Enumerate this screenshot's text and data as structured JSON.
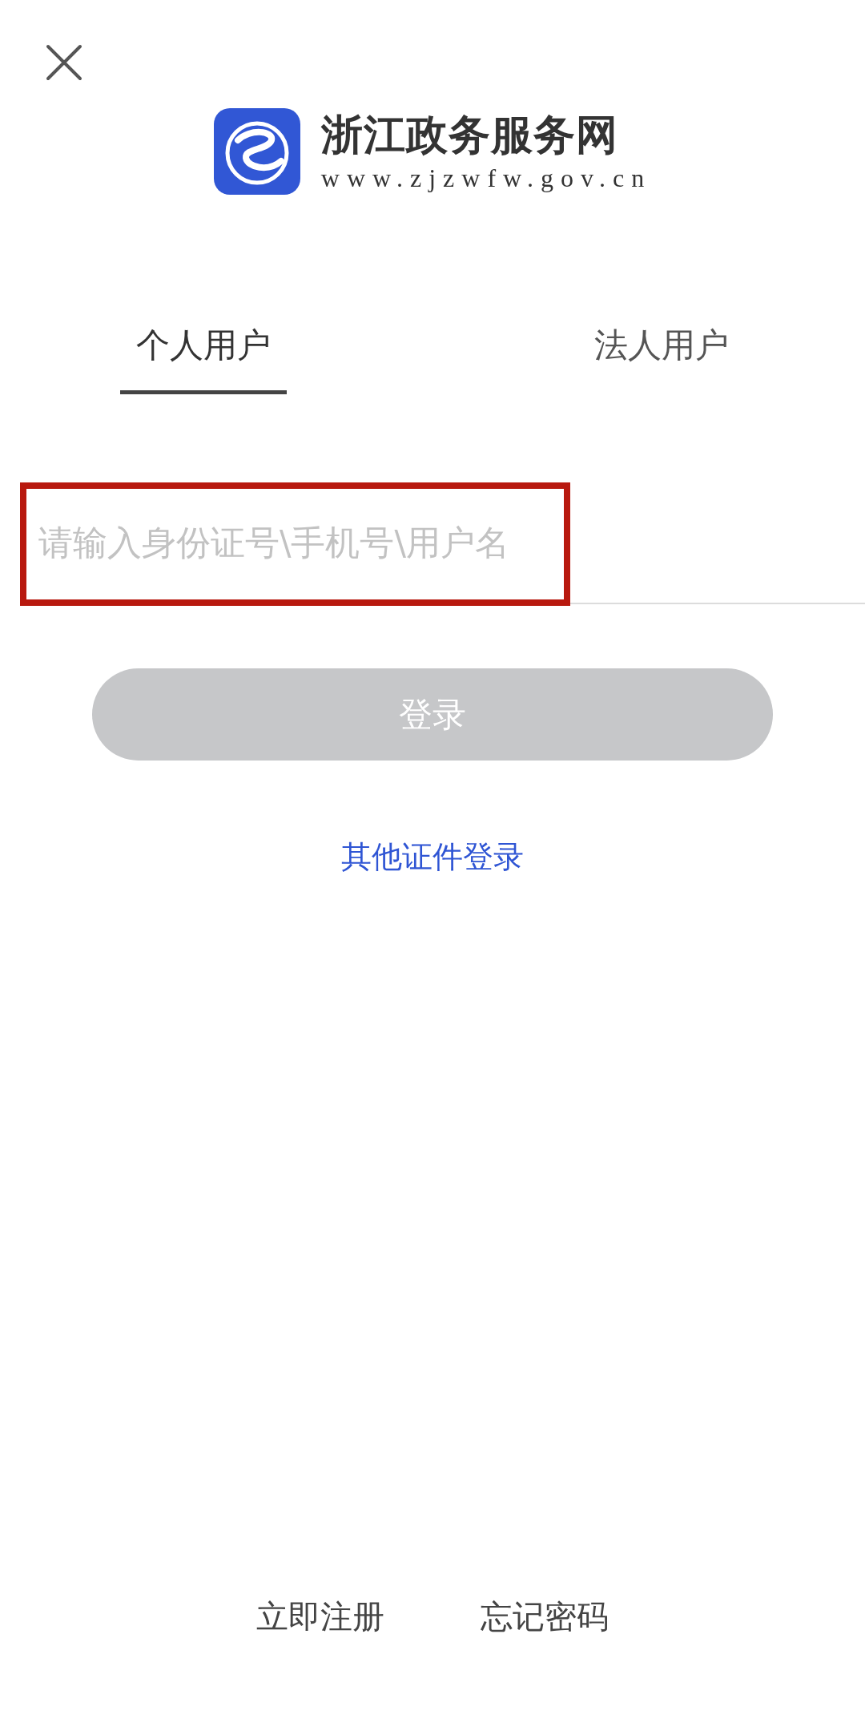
{
  "header": {
    "title": "浙江政务服务网",
    "url": "www.zjzwfw.gov.cn"
  },
  "tabs": [
    {
      "label": "个人用户",
      "selected": true
    },
    {
      "label": "法人用户",
      "selected": false
    }
  ],
  "account_field": {
    "placeholder": "请输入身份证号\\手机号\\用户名",
    "highlighted": true
  },
  "login_button": {
    "label": "登录",
    "disabled": true
  },
  "other_login_link": "其他证件登录",
  "footer_links": [
    "立即注册",
    "忘记密码"
  ]
}
